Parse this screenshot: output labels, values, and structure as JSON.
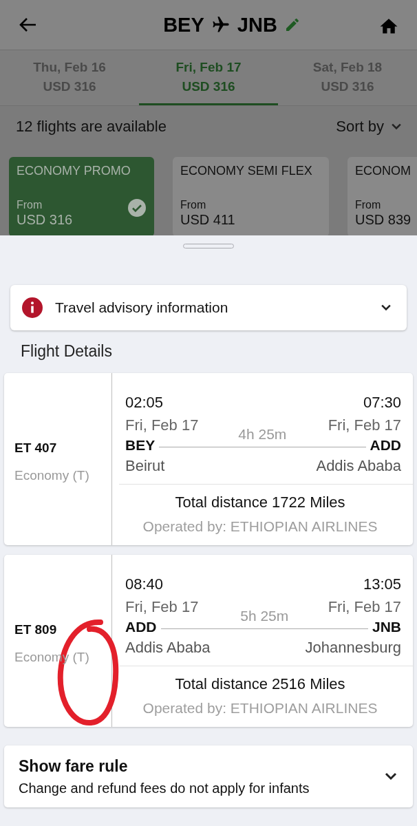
{
  "header": {
    "from_code": "BEY",
    "to_code": "JNB"
  },
  "date_tabs": [
    {
      "day": "Thu, Feb 16",
      "price": "USD 316",
      "selected": false
    },
    {
      "day": "Fri, Feb 17",
      "price": "USD 316",
      "selected": true
    },
    {
      "day": "Sat, Feb 18",
      "price": "USD 316",
      "selected": false
    }
  ],
  "results": {
    "count_text": "12 flights are available",
    "sort_label": "Sort by"
  },
  "fares": [
    {
      "name": "ECONOMY PROMO",
      "from_label": "From",
      "price": "USD 316",
      "selected": true
    },
    {
      "name": "ECONOMY SEMI FLEX",
      "from_label": "From",
      "price": "USD 411",
      "selected": false
    },
    {
      "name": "ECONOM",
      "from_label": "From",
      "price": "USD 839",
      "selected": false
    }
  ],
  "advisory": {
    "label": "Travel advisory information"
  },
  "section_title": "Flight Details",
  "segments": [
    {
      "flight": "ET 407",
      "cabin": "Economy (T)",
      "dep_time": "02:05",
      "arr_time": "07:30",
      "dep_date": "Fri, Feb 17",
      "arr_date": "Fri, Feb 17",
      "duration": "4h 25m",
      "from_code": "BEY",
      "to_code": "ADD",
      "from_city": "Beirut",
      "to_city": "Addis Ababa",
      "distance": "Total distance 1722 Miles",
      "operator": "Operated by: ETHIOPIAN AIRLINES"
    },
    {
      "flight": "ET 809",
      "cabin": "Economy (T)",
      "dep_time": "08:40",
      "arr_time": "13:05",
      "dep_date": "Fri, Feb 17",
      "arr_date": "Fri, Feb 17",
      "duration": "5h 25m",
      "from_code": "ADD",
      "to_code": "JNB",
      "from_city": "Addis Ababa",
      "to_city": "Johannesburg",
      "distance": "Total distance 2516 Miles",
      "operator": "Operated by: ETHIOPIAN AIRLINES"
    }
  ],
  "fare_rule": {
    "title": "Show fare rule",
    "subtitle": "Change and refund fees do not apply for infants"
  }
}
